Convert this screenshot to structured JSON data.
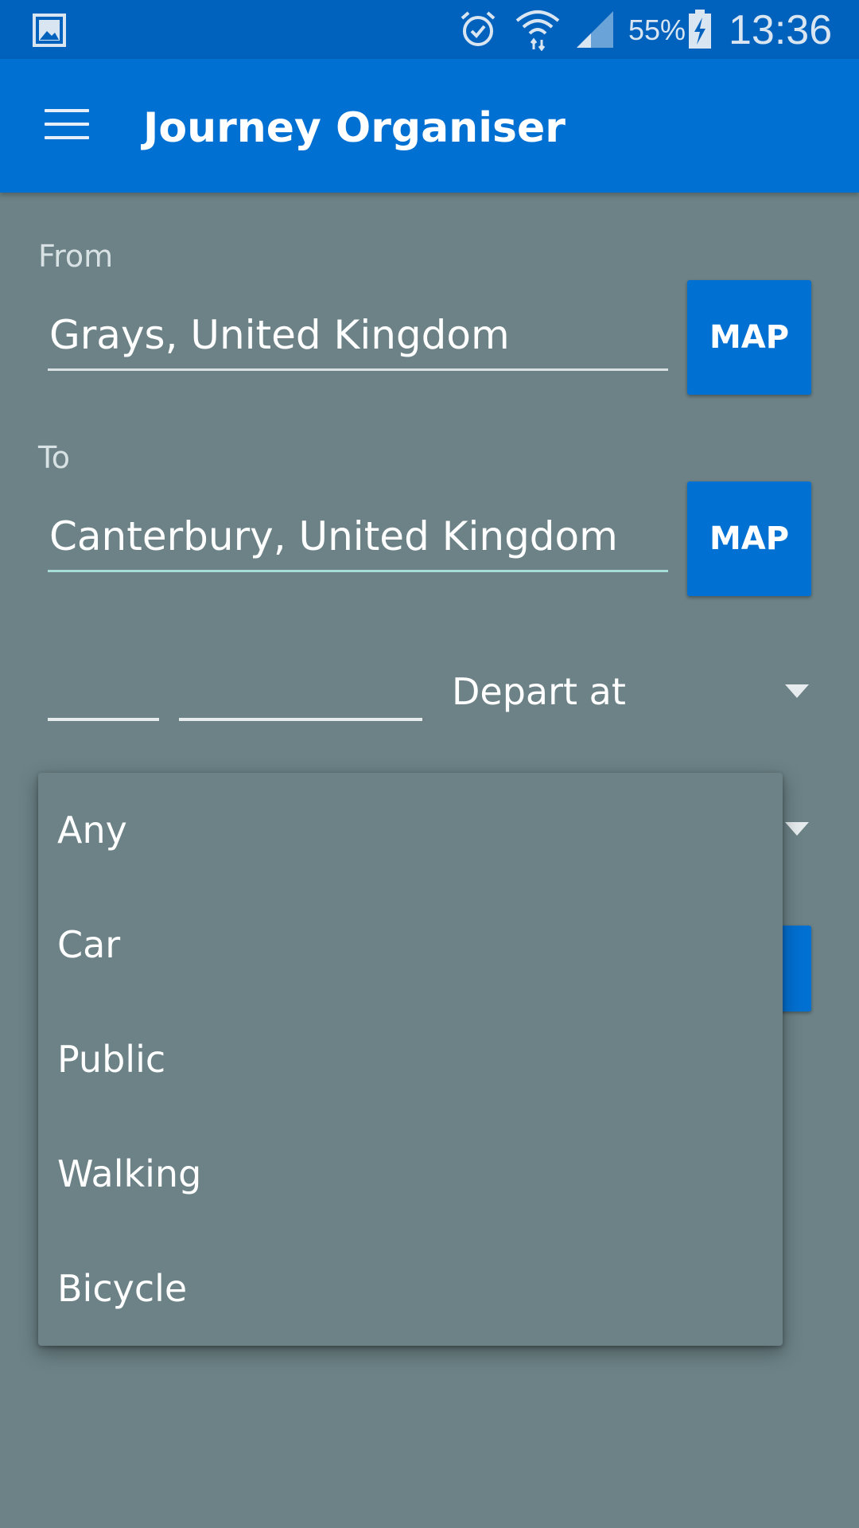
{
  "status_bar": {
    "battery_percent": "55%",
    "time": "13:36",
    "icons": [
      "gallery-icon",
      "alarm-icon",
      "wifi-icon",
      "signal-icon",
      "battery-charging-icon"
    ]
  },
  "app_bar": {
    "title": "Journey Organiser",
    "menu_icon": "menu-icon"
  },
  "form": {
    "from_label": "From",
    "from_value": "Grays, United Kingdom",
    "to_label": "To",
    "to_value": "Canterbury, United Kingdom",
    "map_label": "MAP",
    "time_mode": "Depart at"
  },
  "transport_dropdown": {
    "options": [
      "Any",
      "Car",
      "Public",
      "Walking",
      "Bicycle"
    ]
  },
  "colors": {
    "status_bar": "#0062bd",
    "app_bar": "#0070d2",
    "background": "#6c8286",
    "accent": "#0070d2"
  }
}
